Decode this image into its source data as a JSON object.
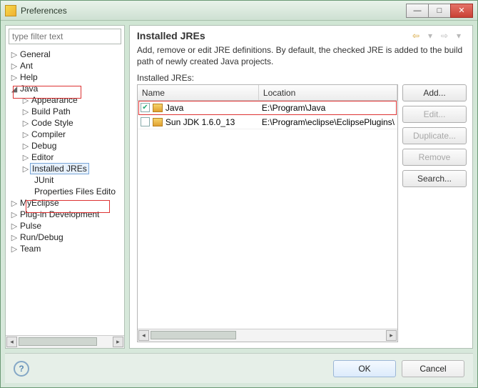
{
  "window": {
    "title": "Preferences"
  },
  "filter": {
    "placeholder": "type filter text"
  },
  "tree": {
    "general": "General",
    "ant": "Ant",
    "help": "Help",
    "java": "Java",
    "java_children": {
      "appearance": "Appearance",
      "build_path": "Build Path",
      "code_style": "Code Style",
      "compiler": "Compiler",
      "debug": "Debug",
      "editor": "Editor",
      "installed_jres": "Installed JREs",
      "junit": "JUnit",
      "properties_files_editor": "Properties Files Edito"
    },
    "myeclipse": "MyEclipse",
    "plugin_dev": "Plug-in Development",
    "pulse": "Pulse",
    "run_debug": "Run/Debug",
    "team": "Team"
  },
  "page": {
    "title": "Installed JREs",
    "description": "Add, remove or edit JRE definitions. By default, the checked JRE is added to the build path of newly created Java projects.",
    "list_label": "Installed JREs:"
  },
  "table": {
    "cols": {
      "name": "Name",
      "location": "Location"
    },
    "rows": [
      {
        "checked": true,
        "name": "Java",
        "location": "E:\\Program\\Java"
      },
      {
        "checked": false,
        "name": "Sun JDK 1.6.0_13",
        "location": "E:\\Program\\eclipse\\EclipsePlugins\\"
      }
    ]
  },
  "buttons": {
    "add": "Add...",
    "edit": "Edit...",
    "duplicate": "Duplicate...",
    "remove": "Remove",
    "search": "Search..."
  },
  "footer": {
    "ok": "OK",
    "cancel": "Cancel"
  }
}
